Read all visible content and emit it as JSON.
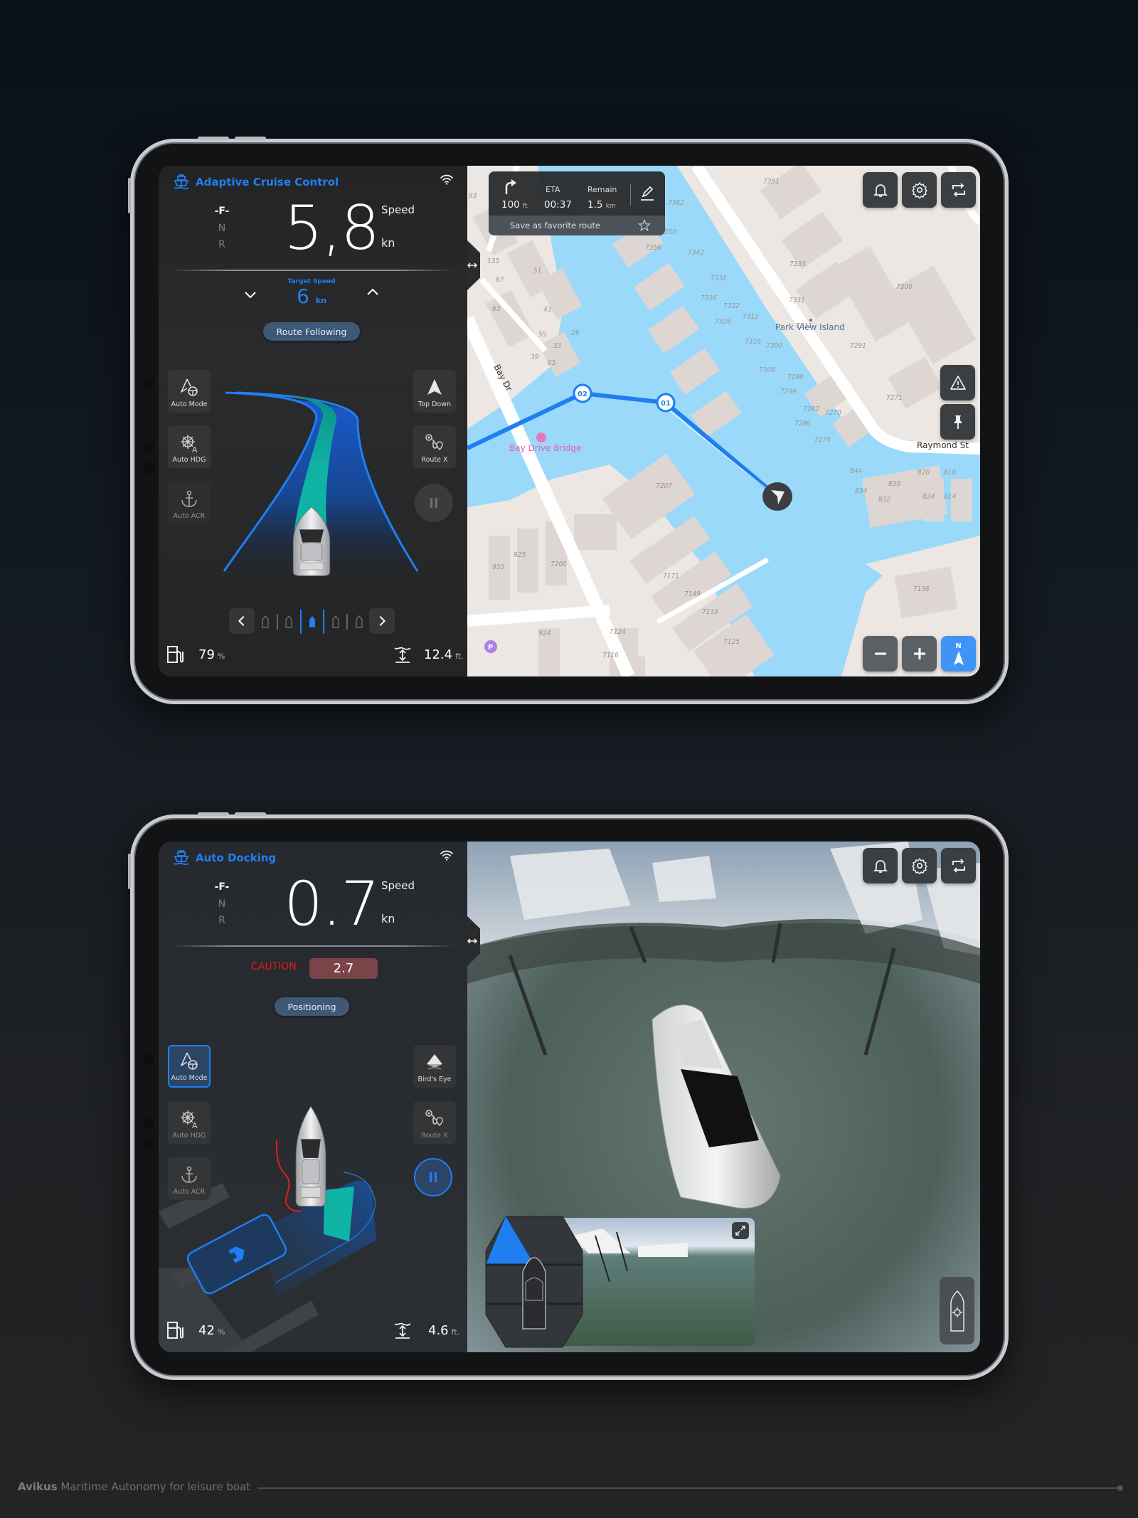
{
  "colors": {
    "accent": "#1f7ff0",
    "teal": "#0fb3a4",
    "caution": "#e01e1e",
    "caution_bg": "#7a4448",
    "water": "#9bd9fb",
    "land": "#ece7e3",
    "building": "#ddd6d2"
  },
  "acc": {
    "title": "Adaptive Cruise Control",
    "title_icon": "boat-wheel-icon",
    "gear": {
      "forward": "-F-",
      "neutral": "N",
      "reverse": "R"
    },
    "speed": {
      "value": "5,8",
      "label": "Speed",
      "unit": "kn"
    },
    "target": {
      "label": "Target Speed",
      "value": "6",
      "unit": "kn"
    },
    "status_pill": "Route Following",
    "modes": [
      {
        "label": "Auto Mode",
        "icon": "auto-mode-icon"
      },
      {
        "label": "Auto HDG",
        "icon": "helm-icon"
      },
      {
        "label": "Auto ACR",
        "icon": "anchor-icon"
      }
    ],
    "views": [
      {
        "label": "Top Down",
        "icon": "arrow-up-icon"
      },
      {
        "label": "Route X",
        "icon": "route-icon"
      }
    ],
    "lane_selected": 3,
    "lane_count": 5,
    "fuel": {
      "value": "79",
      "unit": "%"
    },
    "depth": {
      "value": "12.4",
      "unit": "ft."
    },
    "nav": {
      "distance": "100",
      "distance_unit": "ft",
      "eta_label": "ETA",
      "eta": "00:37",
      "remain_label": "Remain",
      "remain": "1.5",
      "remain_unit": "km",
      "favorite": "Save as favorite route"
    },
    "map": {
      "place": "Park View Island",
      "road1": "Bay Dr",
      "bridge": "Bay Drive Bridge",
      "road2": "Raymond St",
      "waypoints": [
        "02",
        "01"
      ],
      "house_numbers": [
        "93",
        "135",
        "51",
        "67",
        "63",
        "43",
        "55",
        "29",
        "33",
        "39",
        "65",
        "7362",
        "7350",
        "7356",
        "7342",
        "7332",
        "7336",
        "7322",
        "7326",
        "7312",
        "7316",
        "7351",
        "7333",
        "7331",
        "7311",
        "7300",
        "7300",
        "7306",
        "7290",
        "7294",
        "7282",
        "7286",
        "7270",
        "7274",
        "7291",
        "7271",
        "844",
        "834",
        "832",
        "830",
        "820",
        "824",
        "810",
        "814",
        "7207",
        "7200",
        "935",
        "925",
        "7171",
        "7149",
        "7133",
        "7124",
        "7116",
        "924",
        "7125",
        "7136"
      ],
      "north_label": "N"
    }
  },
  "dock": {
    "title": "Auto Docking",
    "gear": {
      "forward": "-F-",
      "neutral": "N",
      "reverse": "R"
    },
    "speed": {
      "value": "0.7",
      "label": "Speed",
      "unit": "kn"
    },
    "caution": {
      "label": "CAUTION",
      "value": "2.7"
    },
    "status_pill": "Positioning",
    "modes": [
      {
        "label": "Auto Mode",
        "icon": "auto-mode-icon",
        "selected": true
      },
      {
        "label": "Auto HDG",
        "icon": "helm-icon"
      },
      {
        "label": "Auto ACR",
        "icon": "anchor-icon"
      }
    ],
    "views": [
      {
        "label": "Bird's Eye",
        "icon": "birds-eye-icon"
      },
      {
        "label": "Route X",
        "icon": "route-icon"
      }
    ],
    "fuel": {
      "value": "42",
      "unit": "%"
    },
    "depth": {
      "value": "4.6",
      "unit": "ft."
    }
  },
  "footer": {
    "brand": "Avikus",
    "tagline": "Maritime Autonomy for leisure boat"
  }
}
